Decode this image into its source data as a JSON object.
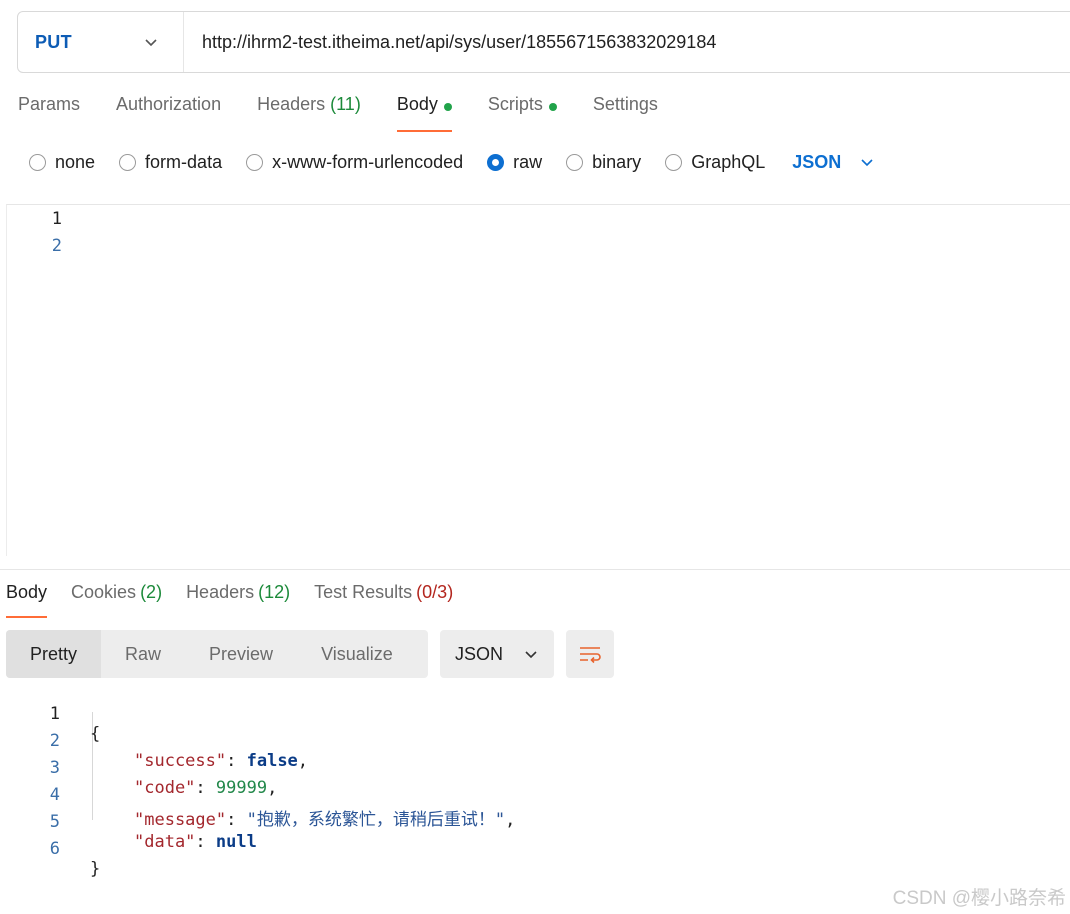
{
  "request": {
    "method": "PUT",
    "url": "http://ihrm2-test.itheima.net/api/sys/user/1855671563832029184"
  },
  "request_tabs": [
    {
      "label": "Params",
      "count": "",
      "dot": false
    },
    {
      "label": "Authorization",
      "count": "",
      "dot": false
    },
    {
      "label": "Headers",
      "count": "(11)",
      "dot": false
    },
    {
      "label": "Body",
      "count": "",
      "dot": true,
      "active": true
    },
    {
      "label": "Scripts",
      "count": "",
      "dot": true
    },
    {
      "label": "Settings",
      "count": "",
      "dot": false
    }
  ],
  "body_types": {
    "options": [
      "none",
      "form-data",
      "x-www-form-urlencoded",
      "raw",
      "binary",
      "GraphQL"
    ],
    "selected": "raw",
    "language": "JSON"
  },
  "editor": {
    "line_numbers": [
      "1",
      "2"
    ]
  },
  "response_tabs": [
    {
      "label": "Body",
      "count": "",
      "active": true
    },
    {
      "label": "Cookies",
      "count": "(2)"
    },
    {
      "label": "Headers",
      "count": "(12)"
    },
    {
      "label": "Test Results",
      "count": "(0/3)"
    }
  ],
  "view_modes": [
    "Pretty",
    "Raw",
    "Preview",
    "Visualize"
  ],
  "view_selected": "Pretty",
  "format": "JSON",
  "response_body": {
    "lines": [
      "1",
      "2",
      "3",
      "4",
      "5",
      "6"
    ],
    "open_brace": "{",
    "close_brace": "}",
    "success_key": "\"success\"",
    "success_val": "false",
    "code_key": "\"code\"",
    "code_val": "99999",
    "message_key": "\"message\"",
    "message_val": "\"抱歉，系统繁忙，请稍后重试！\"",
    "data_key": "\"data\"",
    "data_val": "null"
  },
  "watermark": "CSDN @樱小路奈希",
  "colors": {
    "accent": "#ff6c37",
    "method": "#0d5cb5",
    "selected_radio": "#0d6fd1",
    "count_green": "#1c8a3a",
    "count_red": "#b3261e"
  }
}
